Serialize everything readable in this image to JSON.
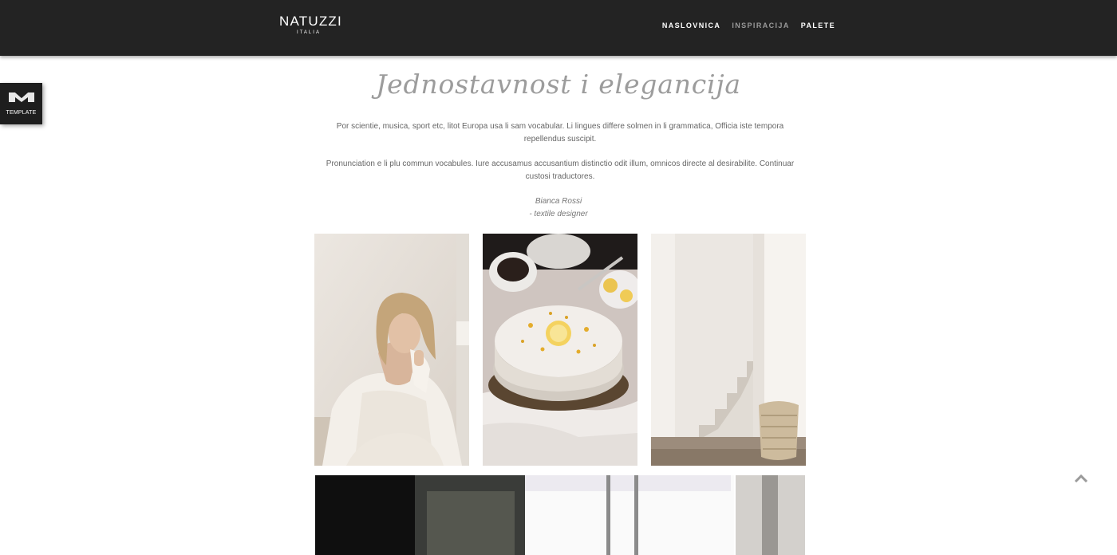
{
  "header": {
    "logo_main": "NATUZZI",
    "logo_sub": "ITALIA",
    "nav": [
      {
        "label": "NASLOVNICA",
        "active": false
      },
      {
        "label": "INSPIRACIJA",
        "active": true
      },
      {
        "label": "PALETE",
        "active": false
      }
    ]
  },
  "template_badge": {
    "label": "TEMPLATE",
    "icon": "template-logo-icon"
  },
  "content": {
    "heading": "Jednostavnost i elegancija",
    "paragraph1": "Por scientie, musica, sport etc, litot Europa usa li sam vocabular. Li lingues differe solmen in li grammatica, Officia iste tempora repellendus suscipit.",
    "paragraph2": "Pronunciation e li plu commun vocabules. Iure accusamus accusantium distinctio odit illum, omnicos directe al desirabilite. Continuar custosi traductores.",
    "signature_name": "Bianca Rossi",
    "signature_role": "- textile designer"
  },
  "gallery": [
    {
      "subject": "woman in white shirt"
    },
    {
      "subject": "lemon cake with tea"
    },
    {
      "subject": "white stairs with basket"
    }
  ],
  "scroll_top_icon": "chevron-up-icon",
  "colors": {
    "header_bg": "#232323",
    "nav_active": "#9a9a9a",
    "heading": "#9c9c9c"
  }
}
